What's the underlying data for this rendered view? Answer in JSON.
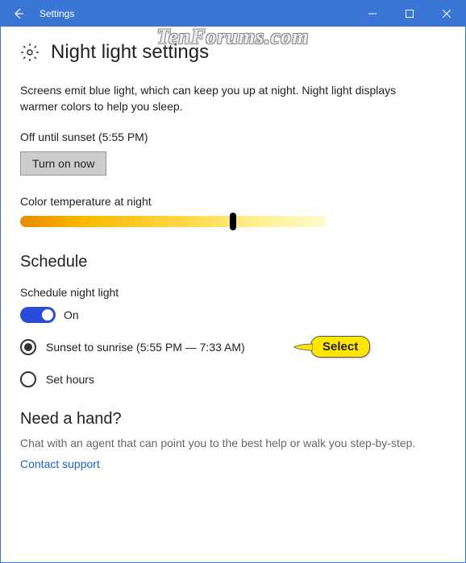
{
  "window": {
    "title": "Settings"
  },
  "watermark": "TenForums.com",
  "page": {
    "heading": "Night light settings",
    "description": "Screens emit blue light, which can keep you up at night. Night light displays warmer colors to help you sleep.",
    "status": "Off until sunset (5:55 PM)",
    "turn_on_label": "Turn on now",
    "color_temp_label": "Color temperature at night",
    "slider_value_pct": 68
  },
  "schedule": {
    "heading": "Schedule",
    "label": "Schedule night light",
    "toggle_state": "On",
    "options": {
      "sunset": "Sunset to sunrise (5:55 PM — 7:33 AM)",
      "set_hours": "Set hours"
    },
    "selected": "sunset"
  },
  "callout": {
    "text": "Select"
  },
  "help": {
    "heading": "Need a hand?",
    "description": "Chat with an agent that can point you to the best help or walk you step-by-step.",
    "link": "Contact support"
  },
  "icons": {
    "back": "back-arrow",
    "gear": "gear",
    "minimize": "minimize",
    "maximize": "maximize",
    "close": "close"
  }
}
